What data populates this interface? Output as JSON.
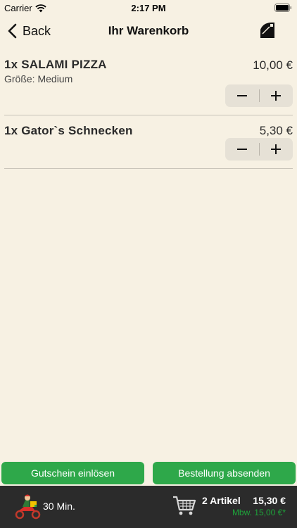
{
  "status_bar": {
    "carrier": "Carrier",
    "time": "2:17 PM"
  },
  "nav": {
    "back_label": "Back",
    "title": "Ihr Warenkorb"
  },
  "cart": {
    "items": [
      {
        "name": "1x SALAMI PIZZA",
        "option": "Größe: Medium",
        "price": "10,00 €"
      },
      {
        "name": "1x Gator`s Schnecken",
        "price": "5,30 €"
      }
    ]
  },
  "actions": {
    "voucher_label": "Gutschein einlösen",
    "order_label": "Bestellung absenden",
    "color": "#2ea84a"
  },
  "footer": {
    "delivery_time": "30 Min.",
    "count": "2 Artikel",
    "total": "15,30 €",
    "minimum": "Mbw. 15,00 €*",
    "minimum_color": "#1ea43a"
  },
  "icons": [
    "wifi-icon",
    "battery-icon",
    "back-chevron-icon",
    "checkout-icon",
    "minus-icon",
    "plus-icon",
    "delivery-scooter-icon",
    "shopping-cart-icon"
  ]
}
